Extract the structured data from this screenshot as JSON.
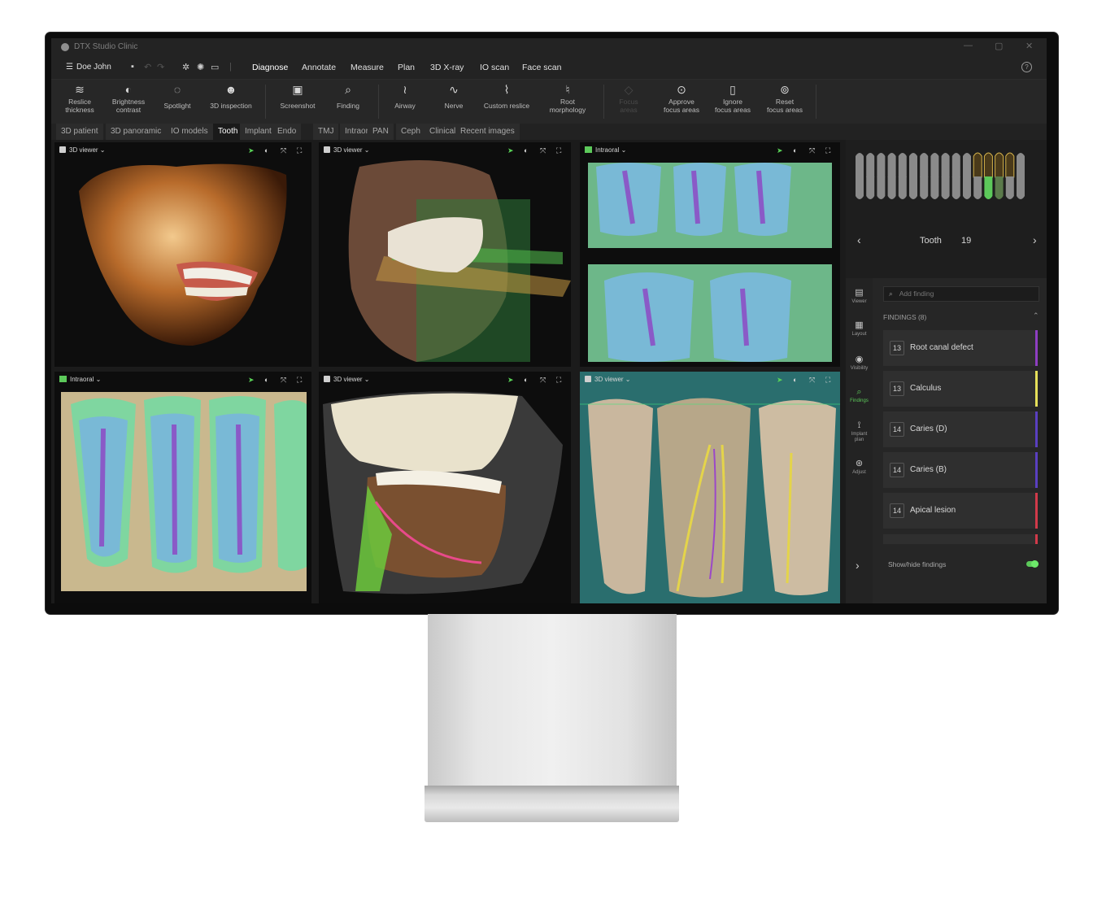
{
  "app": {
    "title": "DTX Studio Clinic"
  },
  "menu": {
    "user": "Doe John",
    "items": [
      "Diagnose",
      "Annotate",
      "Measure",
      "Plan",
      "3D X-ray",
      "IO scan",
      "Face scan"
    ]
  },
  "toolbar": {
    "tools": [
      {
        "label": "Reslice\nthickness",
        "icon": "layers-icon",
        "glyph": "≋"
      },
      {
        "label": "Brightness\ncontrast",
        "icon": "contrast-icon",
        "glyph": "◐"
      },
      {
        "label": "Spotlight",
        "icon": "spotlight-icon",
        "glyph": "◌"
      },
      {
        "label": "3D inspection",
        "icon": "head-inspection-icon",
        "glyph": "☻"
      },
      {
        "label": "Screenshot",
        "icon": "screenshot-icon",
        "glyph": "▣"
      },
      {
        "label": "Finding",
        "icon": "finding-search-icon",
        "glyph": "⌕"
      },
      {
        "label": "Airway",
        "icon": "airway-icon",
        "glyph": "≀"
      },
      {
        "label": "Nerve",
        "icon": "nerve-icon",
        "glyph": "∿"
      },
      {
        "label": "Custom reslice",
        "icon": "custom-reslice-icon",
        "glyph": "⌇"
      },
      {
        "label": "Root\nmorphology",
        "icon": "root-morphology-icon",
        "glyph": "♮"
      },
      {
        "label": "Focus\nareas",
        "icon": "focus-disabled-icon",
        "glyph": "◇"
      },
      {
        "label": "Approve\nfocus areas",
        "icon": "approve-focus-icon",
        "glyph": "⊙"
      },
      {
        "label": "Ignore\nfocus areas",
        "icon": "ignore-focus-icon",
        "glyph": "▯"
      },
      {
        "label": "Reset\nfocus areas",
        "icon": "reset-focus-icon",
        "glyph": "⊚"
      }
    ]
  },
  "tabs": [
    {
      "label": "3D patient",
      "active": false
    },
    {
      "label": "3D panoramic",
      "active": false
    },
    {
      "label": "IO models",
      "active": false
    },
    {
      "label": "Tooth",
      "active": true
    },
    {
      "label": "Implant",
      "active": false
    },
    {
      "label": "Endo",
      "active": false
    },
    {
      "label": "TMJ",
      "active": false
    },
    {
      "label": "Intraoral RX",
      "active": false
    },
    {
      "label": "PAN",
      "active": false
    },
    {
      "label": "Ceph",
      "active": false
    },
    {
      "label": "Clinical pictures",
      "active": false
    },
    {
      "label": "Recent images",
      "active": false
    }
  ],
  "viewports": [
    {
      "title": "3D viewer",
      "kind": "3d"
    },
    {
      "title": "3D viewer",
      "kind": "3d"
    },
    {
      "title": "Intraoral",
      "kind": "io"
    },
    {
      "title": "Intraoral",
      "kind": "io"
    },
    {
      "title": "3D viewer",
      "kind": "3d"
    },
    {
      "title": "3D viewer",
      "kind": "3d"
    }
  ],
  "tooth_nav": {
    "label": "Tooth",
    "number": "19"
  },
  "side_strip": [
    {
      "label": "Viewer",
      "icon": "viewer-icon",
      "glyph": "▤",
      "active": false
    },
    {
      "label": "Layout",
      "icon": "layout-icon",
      "glyph": "▦",
      "active": false
    },
    {
      "label": "Visibility",
      "icon": "eye-icon",
      "glyph": "◉",
      "active": false
    },
    {
      "label": "Findings",
      "icon": "findings-icon",
      "glyph": "⌕",
      "active": true
    },
    {
      "label": "Implant\nplan",
      "icon": "implant-plan-icon",
      "glyph": "⟟",
      "active": false
    },
    {
      "label": "Adjust",
      "icon": "adjust-icon",
      "glyph": "⊛",
      "active": false
    }
  ],
  "findings": {
    "search_placeholder": "Add finding",
    "header": "FINDINGS (8)",
    "items": [
      {
        "tooth": "13",
        "label": "Root canal defect",
        "color": "#8e3ec2"
      },
      {
        "tooth": "13",
        "label": "Calculus",
        "color": "#e6e05a"
      },
      {
        "tooth": "14",
        "label": "Caries (D)",
        "color": "#5a3fc0"
      },
      {
        "tooth": "14",
        "label": "Caries (B)",
        "color": "#5a3fc0"
      },
      {
        "tooth": "14",
        "label": "Apical lesion",
        "color": "#d13a4a"
      }
    ],
    "toggle_label": "Show/hide findings",
    "toggle_on": true
  },
  "colors": {
    "accent": "#5cc95a"
  }
}
